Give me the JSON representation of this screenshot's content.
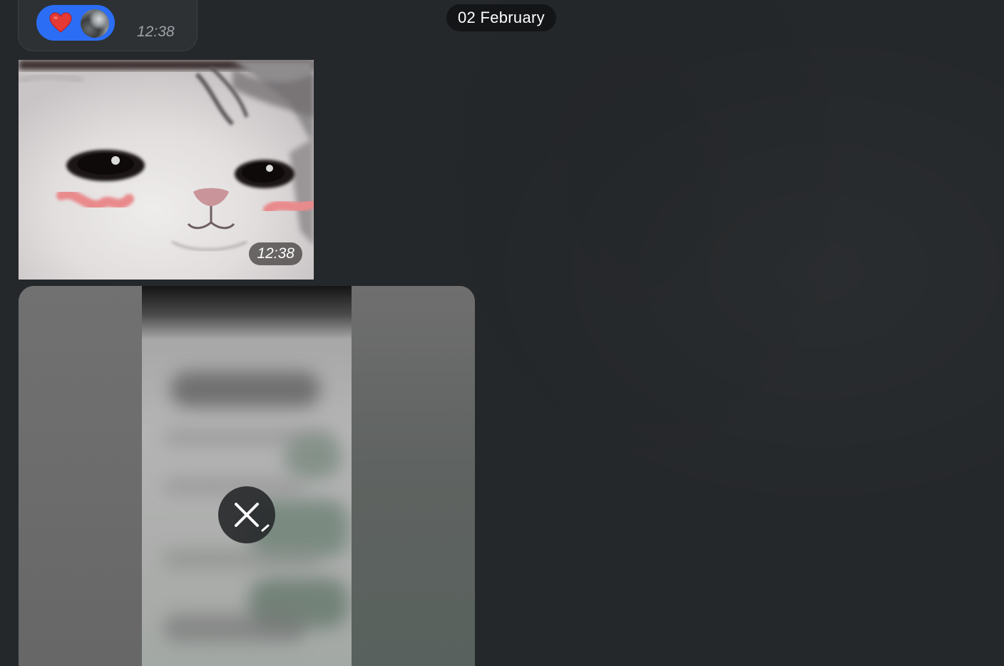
{
  "chat": {
    "date_separator": "02 February",
    "messages": [
      {
        "type": "reaction",
        "reaction": {
          "emoji": "heart-icon",
          "color": "#e53935",
          "chip_color": "#2b6ef5"
        },
        "time": "12:38"
      },
      {
        "type": "sticker",
        "description_icon": "cat-sticker",
        "time": "12:38"
      },
      {
        "type": "media-loading",
        "action_icon": "close-icon",
        "progress": 0.05
      }
    ]
  },
  "colors": {
    "background": "#25282b",
    "date_pill": "#131517",
    "accent": "#2b6ef5"
  }
}
